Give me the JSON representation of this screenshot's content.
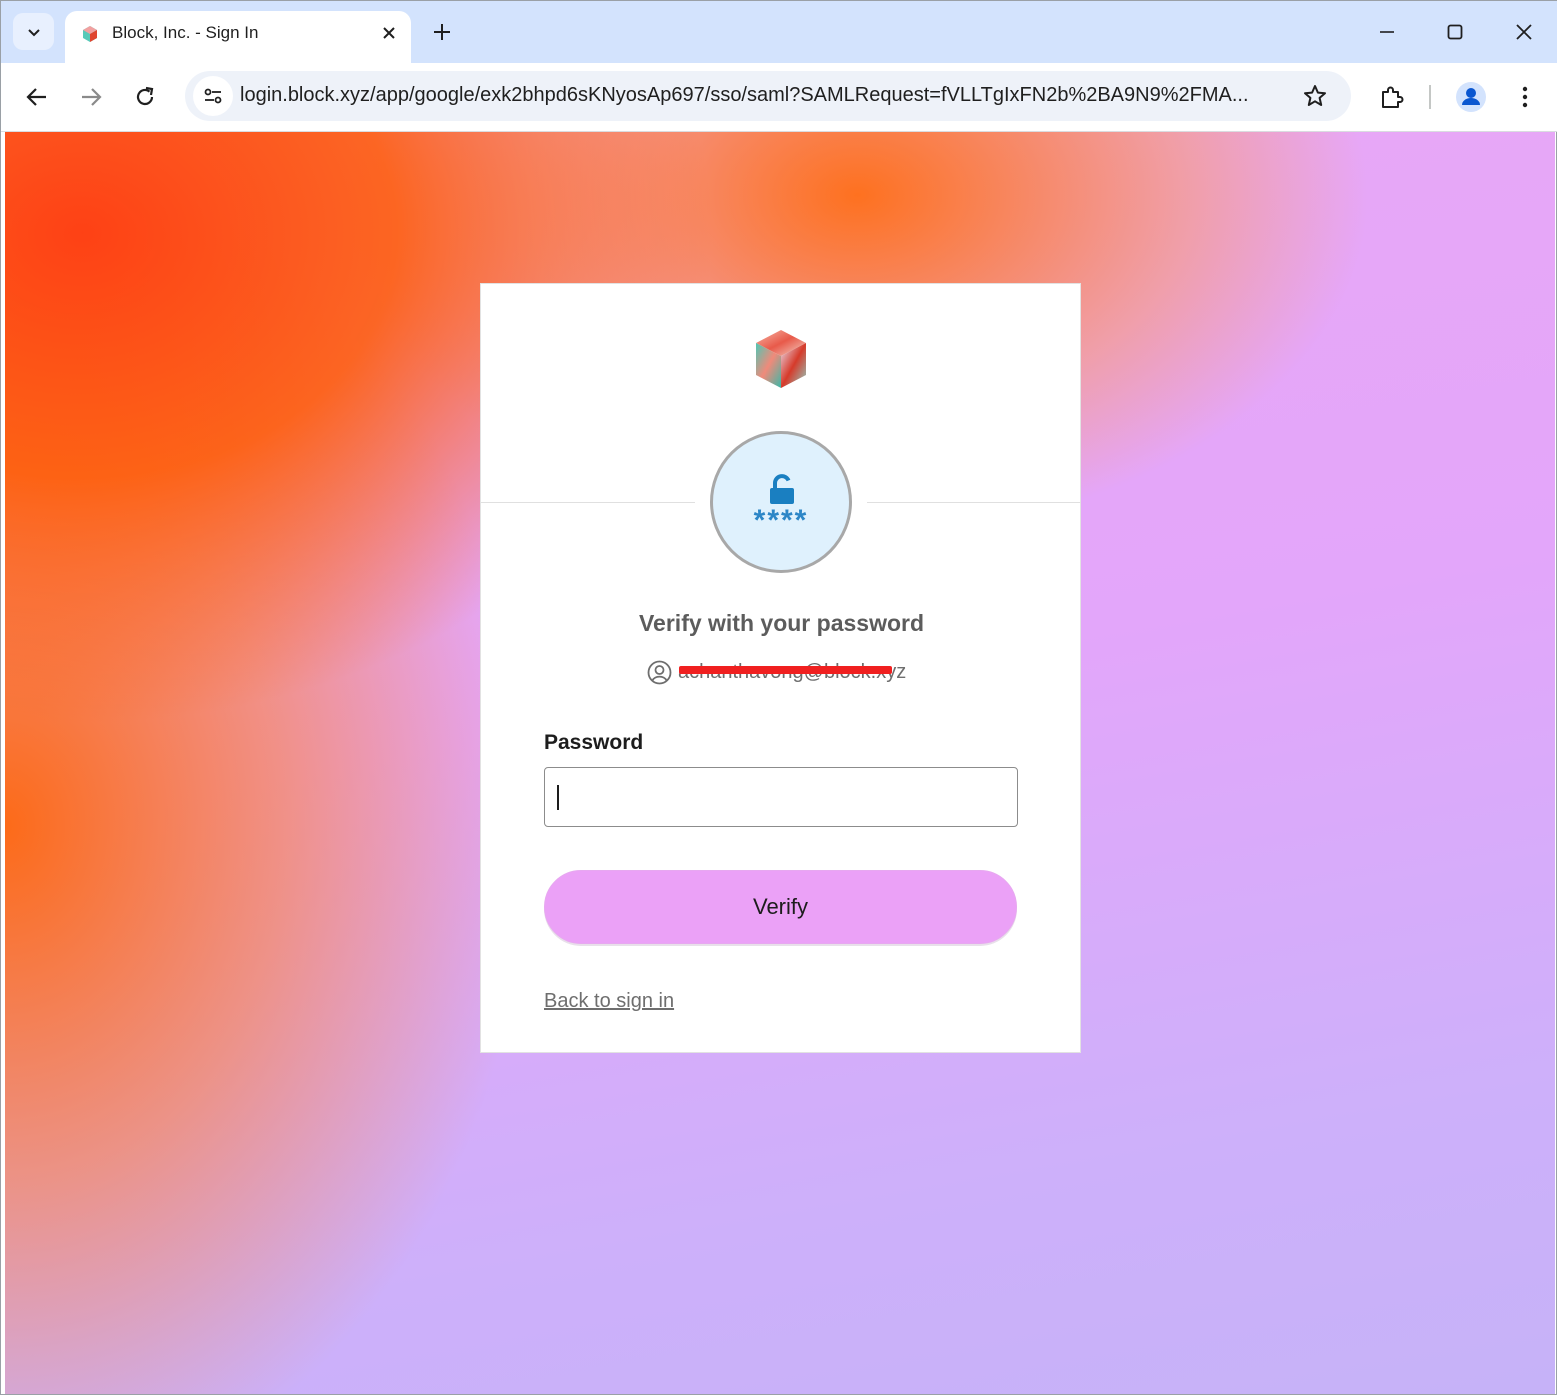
{
  "browser": {
    "tab": {
      "title": "Block, Inc. - Sign In"
    },
    "address_bar": {
      "url": "login.block.xyz/app/google/exk2bhpd6sKNyosAp697/sso/saml?SAMLRequest=fVLLTgIxFN2b%2BA9N9%2FMA..."
    },
    "icons": [
      "tab-search-icon",
      "block-favicon-icon",
      "close-icon",
      "plus-icon",
      "minimize-icon",
      "maximize-icon",
      "window-close-icon",
      "back-arrow-icon",
      "forward-arrow-icon",
      "reload-icon",
      "site-info-icon",
      "star-icon",
      "extensions-icon",
      "profile-icon",
      "more-vert-icon"
    ]
  },
  "signin": {
    "heading": "Verify with your password",
    "identifier": "achanthavong@block.xyz",
    "password_label": "Password",
    "password_value": "",
    "auth_badge_text": "****",
    "verify_label": "Verify",
    "back_link": "Back to sign in"
  },
  "colors": {
    "verify_button": "#eba1f7",
    "auth_circle_bg": "#dff1fd",
    "auth_icon": "#1a7fc1",
    "redaction": "#f02020"
  }
}
